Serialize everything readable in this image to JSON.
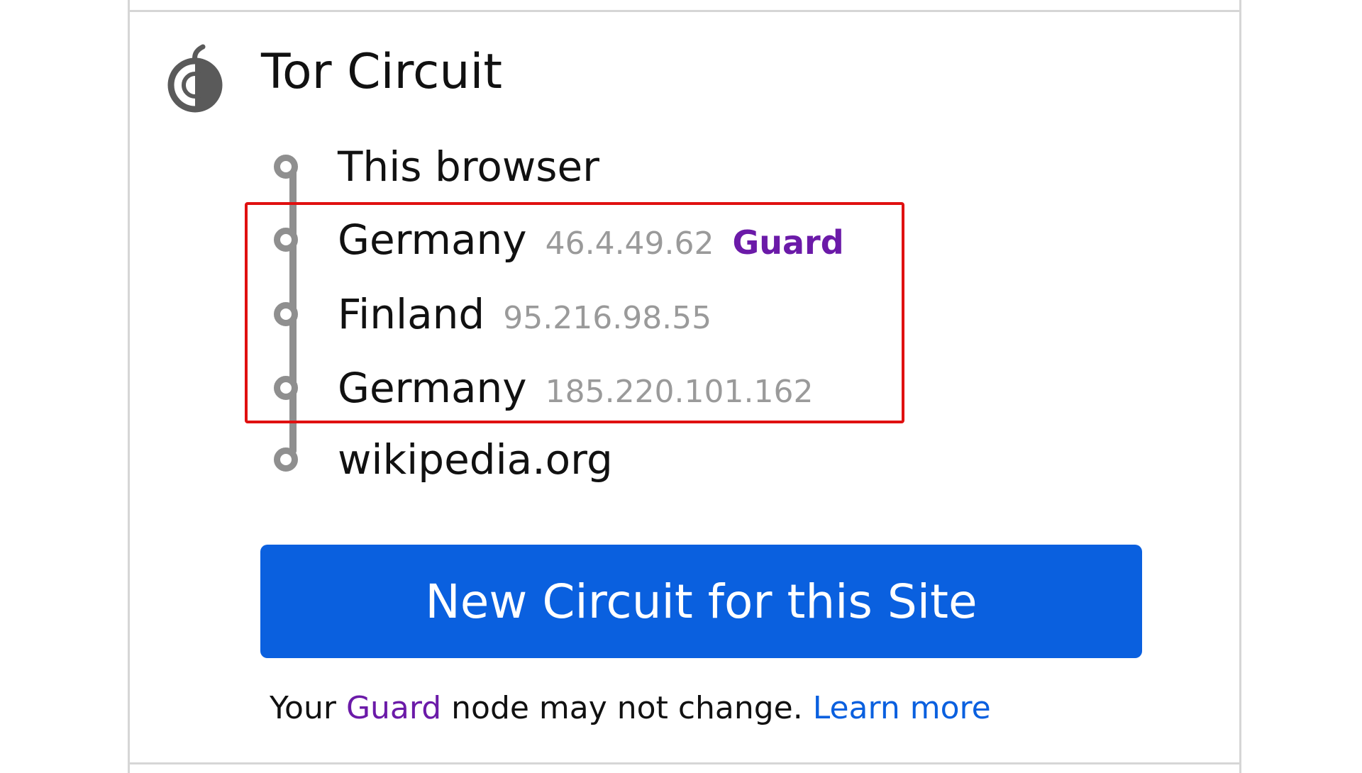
{
  "panel": {
    "title": "Tor Circuit",
    "icon": "onion-icon"
  },
  "circuit": {
    "nodes": [
      {
        "name": "This browser",
        "ip": "",
        "role": ""
      },
      {
        "name": "Germany",
        "ip": "46.4.49.62",
        "role": "Guard"
      },
      {
        "name": "Finland",
        "ip": "95.216.98.55",
        "role": ""
      },
      {
        "name": "Germany",
        "ip": "185.220.101.162",
        "role": ""
      },
      {
        "name": "wikipedia.org",
        "ip": "",
        "role": ""
      }
    ]
  },
  "button": {
    "label": "New Circuit for this Site",
    "color": "#0a60df"
  },
  "footer": {
    "prefix": "Your",
    "guard_word": "Guard",
    "suffix": "node may not change.",
    "link": "Learn more"
  },
  "colors": {
    "guard": "#6b1aa8",
    "highlight": "#e01010",
    "link": "#0a60df"
  }
}
